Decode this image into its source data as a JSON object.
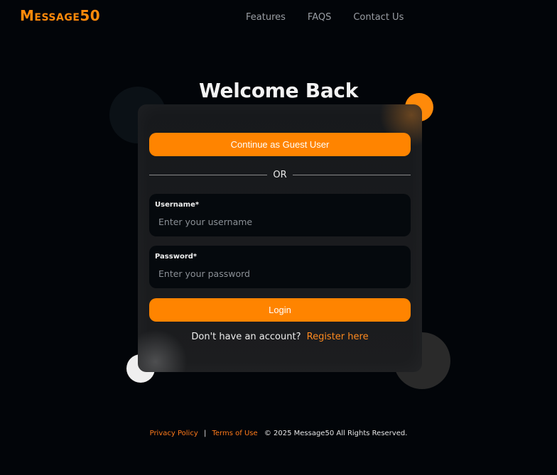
{
  "header": {
    "logo": "Message50",
    "nav": [
      {
        "label": "Features"
      },
      {
        "label": "FAQS"
      },
      {
        "label": "Contact Us"
      }
    ]
  },
  "main": {
    "title": "Welcome Back",
    "guest_button": "Continue as Guest User",
    "divider_text": "OR",
    "username": {
      "label": "Username*",
      "placeholder": "Enter your username",
      "value": ""
    },
    "password": {
      "label": "Password*",
      "placeholder": "Enter your password",
      "value": ""
    },
    "login_button": "Login",
    "register_prompt": "Don't have an account?",
    "register_link": "Register here"
  },
  "footer": {
    "privacy": "Privacy Policy",
    "separator": "|",
    "terms": "Terms of Use",
    "copyright": "© 2025 Message50 All Rights Reserved."
  },
  "colors": {
    "accent": "#ff8400",
    "background": "#020509",
    "card": "#1a1b1e",
    "field": "#05090d"
  }
}
